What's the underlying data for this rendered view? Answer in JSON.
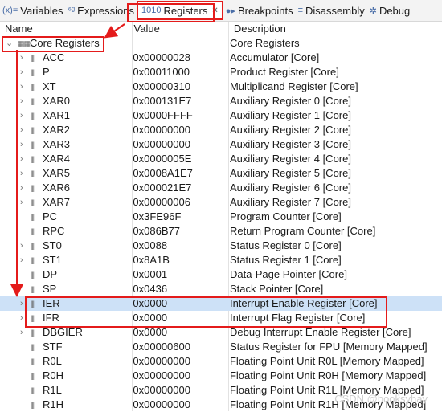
{
  "tabs": [
    {
      "icon": "(x)=",
      "label": "Variables"
    },
    {
      "icon": "⁶ᵍ",
      "label": "Expressions"
    },
    {
      "icon": "1010",
      "label": "Registers",
      "close": "✕"
    },
    {
      "icon": "●▸",
      "label": "Breakpoints"
    },
    {
      "icon": "≡",
      "label": "Disassembly"
    },
    {
      "icon": "✲",
      "label": "Debug"
    }
  ],
  "columns": {
    "name": "Name",
    "value": "Value",
    "description": "Description"
  },
  "rows": [
    {
      "name": "Core Registers",
      "value": "",
      "desc": "Core Registers",
      "group": true
    },
    {
      "name": "ACC",
      "value": "0x00000028",
      "desc": "Accumulator [Core]",
      "exp": true
    },
    {
      "name": "P",
      "value": "0x00011000",
      "desc": "Product Register [Core]",
      "exp": true
    },
    {
      "name": "XT",
      "value": "0x00000310",
      "desc": "Multiplicand Register [Core]",
      "exp": true
    },
    {
      "name": "XAR0",
      "value": "0x000131E7",
      "desc": "Auxiliary Register 0 [Core]",
      "exp": true
    },
    {
      "name": "XAR1",
      "value": "0x0000FFFF",
      "desc": "Auxiliary Register 1 [Core]",
      "exp": true
    },
    {
      "name": "XAR2",
      "value": "0x00000000",
      "desc": "Auxiliary Register 2 [Core]",
      "exp": true
    },
    {
      "name": "XAR3",
      "value": "0x00000000",
      "desc": "Auxiliary Register 3 [Core]",
      "exp": true
    },
    {
      "name": "XAR4",
      "value": "0x0000005E",
      "desc": "Auxiliary Register 4 [Core]",
      "exp": true
    },
    {
      "name": "XAR5",
      "value": "0x0008A1E7",
      "desc": "Auxiliary Register 5 [Core]",
      "exp": true
    },
    {
      "name": "XAR6",
      "value": "0x000021E7",
      "desc": "Auxiliary Register 6 [Core]",
      "exp": true
    },
    {
      "name": "XAR7",
      "value": "0x00000006",
      "desc": "Auxiliary Register 7 [Core]",
      "exp": true
    },
    {
      "name": "PC",
      "value": "0x3FE96F",
      "desc": "Program Counter [Core]",
      "exp": false
    },
    {
      "name": "RPC",
      "value": "0x086B77",
      "desc": "Return Program Counter [Core]",
      "exp": false
    },
    {
      "name": "ST0",
      "value": "0x0088",
      "desc": "Status Register 0 [Core]",
      "exp": true
    },
    {
      "name": "ST1",
      "value": "0x8A1B",
      "desc": "Status Register 1 [Core]",
      "exp": true
    },
    {
      "name": "DP",
      "value": "0x0001",
      "desc": "Data-Page Pointer [Core]",
      "exp": false
    },
    {
      "name": "SP",
      "value": "0x0436",
      "desc": "Stack Pointer [Core]",
      "exp": false
    },
    {
      "name": "IER",
      "value": "0x0000",
      "desc": "Interrupt Enable Register [Core]",
      "exp": true,
      "selected": true
    },
    {
      "name": "IFR",
      "value": "0x0000",
      "desc": "Interrupt Flag Register [Core]",
      "exp": true
    },
    {
      "name": "DBGIER",
      "value": "0x0000",
      "desc": "Debug Interrupt Enable Register [Core]",
      "exp": true
    },
    {
      "name": "STF",
      "value": "0x00000600",
      "desc": "Status Register for FPU [Memory Mapped]",
      "exp": false
    },
    {
      "name": "R0L",
      "value": "0x00000000",
      "desc": "Floating Point Unit R0L [Memory Mapped]",
      "exp": false
    },
    {
      "name": "R0H",
      "value": "0x00000000",
      "desc": "Floating Point Unit R0H [Memory Mapped]",
      "exp": false
    },
    {
      "name": "R1L",
      "value": "0x00000000",
      "desc": "Floating Point Unit R1L [Memory Mapped]",
      "exp": false
    },
    {
      "name": "R1H",
      "value": "0x00000000",
      "desc": "Floating Point Unit R1H [Memory Mapped]",
      "exp": false
    }
  ],
  "watermark": "CSDN @booksyhay",
  "colors": {
    "highlight": "#e41b1b",
    "selection": "#cde1f7"
  }
}
